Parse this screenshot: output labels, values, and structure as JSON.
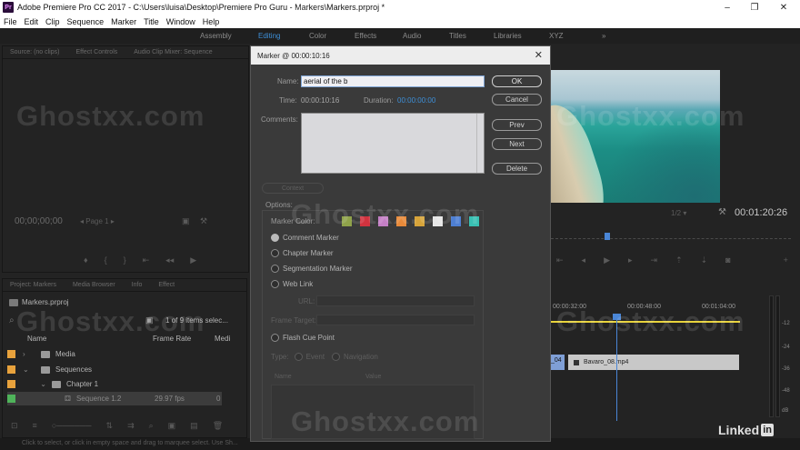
{
  "app": {
    "title": "Adobe Premiere Pro CC 2017 - C:\\Users\\luisa\\Desktop\\Premiere Pro Guru - Markers\\Markers.prproj *",
    "icon_label": "Pr"
  },
  "window_controls": {
    "minimize": "–",
    "maximize": "❐",
    "close": "✕"
  },
  "menu": [
    "File",
    "Edit",
    "Clip",
    "Sequence",
    "Marker",
    "Title",
    "Window",
    "Help"
  ],
  "workspaces": {
    "tabs": [
      "Assembly",
      "Editing",
      "Color",
      "Effects",
      "Audio",
      "Titles",
      "Libraries",
      "XYZ"
    ],
    "active": "Editing",
    "overflow": "»"
  },
  "source_panel": {
    "tabs": [
      "Source: (no clips)",
      "Effect Controls",
      "Audio Clip Mixer: Sequence"
    ],
    "timecode": "00;00;00;00",
    "page": "Page 1"
  },
  "program_monitor": {
    "zoom": "1/2",
    "timecode": "00:01:20:26"
  },
  "project_panel": {
    "tabs": [
      "Project: Markers",
      "Media Browser",
      "Info",
      "Effect"
    ],
    "file": "Markers.prproj",
    "selection": "1 of 9 items selec...",
    "columns": [
      "Name",
      "Frame Rate",
      "Medi"
    ],
    "items": [
      {
        "name": "Media",
        "color": "#e8a23c"
      },
      {
        "name": "Sequences",
        "color": "#e8a23c"
      },
      {
        "name": "Chapter 1",
        "color": "#e8a23c"
      },
      {
        "name": "Sequence 1.2",
        "color": "#4fb35a",
        "frame_rate": "29.97 fps",
        "media": "0"
      }
    ]
  },
  "timeline": {
    "ruler": [
      "00:00:32:00",
      "00:00:48:00",
      "00:01:04:00"
    ],
    "clip_left_label": "_04",
    "clip_name": "Bavaro_08.mp4"
  },
  "meter_labels": [
    "-12",
    "-24",
    "-36",
    "-48",
    "dB"
  ],
  "status_bar": "Click to select, or click in empty space and drag to marquee select. Use Sh...",
  "dialog": {
    "title": "Marker @ 00:00:10:16",
    "close": "✕",
    "name_label": "Name:",
    "name_value": "aerial of the b",
    "time_label": "Time:",
    "time_value": "00:00:10:16",
    "duration_label": "Duration:",
    "duration_value": "00:00:00:00",
    "comments_label": "Comments:",
    "buttons": {
      "ok": "OK",
      "cancel": "Cancel",
      "prev": "Prev",
      "next": "Next",
      "delete": "Delete"
    },
    "context_button": "Context",
    "options_label": "Options:",
    "marker_color_label": "Marker Color:",
    "marker_colors": [
      "#8fa24a",
      "#d2333f",
      "#c47fc5",
      "#e88a3a",
      "#d7a43a",
      "#e6e6e6",
      "#4e7fd2",
      "#39c0b3"
    ],
    "marker_types": [
      {
        "label": "Comment Marker",
        "selected": true
      },
      {
        "label": "Chapter Marker",
        "selected": false
      },
      {
        "label": "Segmentation Marker",
        "selected": false
      },
      {
        "label": "Web Link",
        "selected": false
      }
    ],
    "url_label": "URL:",
    "frame_target_label": "Frame Target:",
    "flash_cue_label": "Flash Cue Point",
    "type_label": "Type:",
    "type_options": [
      "Event",
      "Navigation"
    ],
    "table_columns": [
      "Name",
      "Value"
    ]
  },
  "watermark": "Ghostxx.com",
  "brand": {
    "text": "Linked",
    "in": "in"
  }
}
